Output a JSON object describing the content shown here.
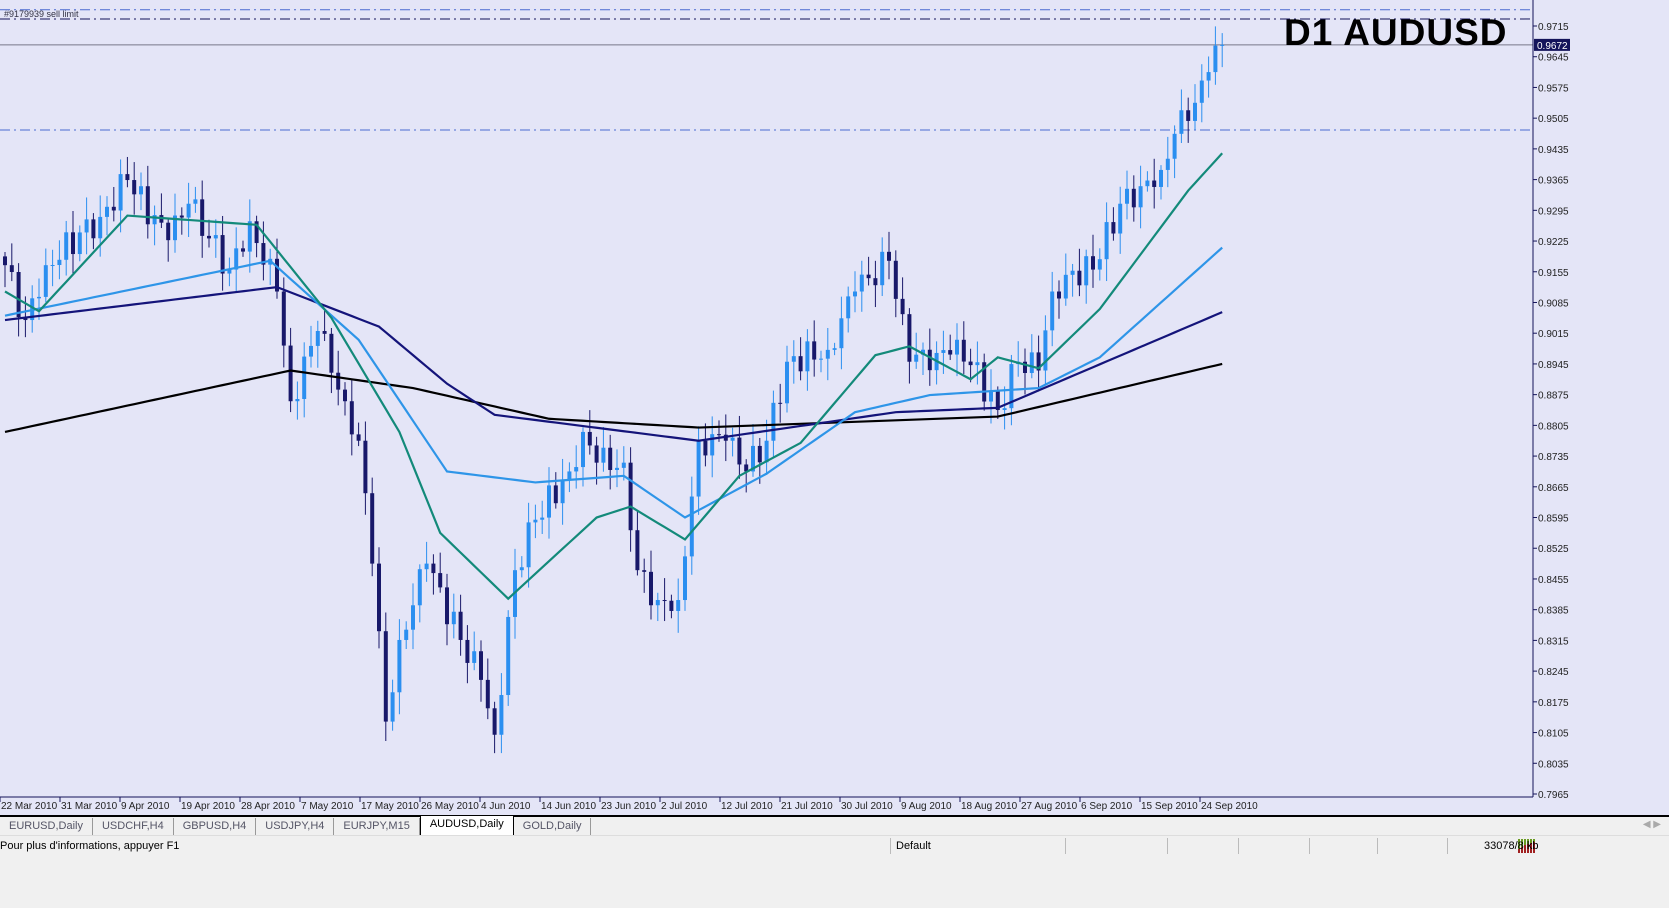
{
  "chart_title": "D1 AUDUSD",
  "order_label": "#9179939 sell limit",
  "current_price": "0.9672",
  "tabs": [
    {
      "label": "EURUSD,Daily",
      "active": false
    },
    {
      "label": "USDCHF,H4",
      "active": false
    },
    {
      "label": "GBPUSD,H4",
      "active": false
    },
    {
      "label": "USDJPY,H4",
      "active": false
    },
    {
      "label": "EURJPY,M15",
      "active": false
    },
    {
      "label": "AUDUSD,Daily",
      "active": true
    },
    {
      "label": "GOLD,Daily",
      "active": false
    }
  ],
  "status": {
    "help": "Pour plus d'informations, appuyer F1",
    "profile": "Default",
    "traffic": "33078/8 kb"
  },
  "colors": {
    "background": "#e4e5f7",
    "bull": "#2b8ff0",
    "bear": "#18186a",
    "ma10": "#138a7a",
    "ma20": "#2e95e8",
    "ma50": "#14147a",
    "ma200": "#000000"
  },
  "chart_data": {
    "type": "candlestick",
    "title": "D1 AUDUSD",
    "ylim": [
      0.7965,
      0.9715
    ],
    "yticks": [
      "0.9715",
      "0.9645",
      "0.9575",
      "0.9505",
      "0.9435",
      "0.9365",
      "0.9295",
      "0.9225",
      "0.9155",
      "0.9085",
      "0.9015",
      "0.8945",
      "0.8875",
      "0.8805",
      "0.8735",
      "0.8665",
      "0.8595",
      "0.8525",
      "0.8455",
      "0.8385",
      "0.8315",
      "0.8245",
      "0.8175",
      "0.8105",
      "0.8035",
      "0.7965"
    ],
    "xticks": [
      "22 Mar 2010",
      "31 Mar 2010",
      "9 Apr 2010",
      "19 Apr 2010",
      "28 Apr 2010",
      "7 May 2010",
      "17 May 2010",
      "26 May 2010",
      "4 Jun 2010",
      "14 Jun 2010",
      "23 Jun 2010",
      "2 Jul 2010",
      "12 Jul 2010",
      "21 Jul 2010",
      "30 Jul 2010",
      "9 Aug 2010",
      "18 Aug 2010",
      "27 Aug 2010",
      "6 Sep 2010",
      "15 Sep 2010",
      "24 Sep 2010"
    ],
    "bars": 180,
    "close_anchors": [
      [
        0,
        0.917
      ],
      [
        3,
        0.9045
      ],
      [
        6,
        0.917
      ],
      [
        14,
        0.928
      ],
      [
        18,
        0.9364
      ],
      [
        24,
        0.9227
      ],
      [
        27,
        0.931
      ],
      [
        33,
        0.916
      ],
      [
        36,
        0.927
      ],
      [
        40,
        0.911
      ],
      [
        42,
        0.886
      ],
      [
        46,
        0.902
      ],
      [
        50,
        0.886
      ],
      [
        52,
        0.877
      ],
      [
        54,
        0.849
      ],
      [
        56,
        0.813
      ],
      [
        58,
        0.8316
      ],
      [
        62,
        0.849
      ],
      [
        67,
        0.8316
      ],
      [
        70,
        0.8225
      ],
      [
        72,
        0.81
      ],
      [
        75,
        0.8475
      ],
      [
        78,
        0.859
      ],
      [
        83,
        0.87
      ],
      [
        85,
        0.879
      ],
      [
        87,
        0.872
      ],
      [
        91,
        0.872
      ],
      [
        93,
        0.8475
      ],
      [
        96,
        0.8407
      ],
      [
        99,
        0.8407
      ],
      [
        102,
        0.877
      ],
      [
        106,
        0.877
      ],
      [
        109,
        0.87
      ],
      [
        112,
        0.877
      ],
      [
        115,
        0.895
      ],
      [
        121,
        0.8977
      ],
      [
        125,
        0.911
      ],
      [
        130,
        0.918
      ],
      [
        133,
        0.895
      ],
      [
        137,
        0.897
      ],
      [
        140,
        0.9
      ],
      [
        146,
        0.884
      ],
      [
        149,
        0.895
      ],
      [
        152,
        0.893
      ],
      [
        154,
        0.911
      ],
      [
        156,
        0.9148
      ],
      [
        160,
        0.916
      ],
      [
        164,
        0.931
      ],
      [
        167,
        0.935
      ],
      [
        170,
        0.9387
      ],
      [
        173,
        0.9523
      ],
      [
        175,
        0.954
      ],
      [
        177,
        0.961
      ],
      [
        179,
        0.9672
      ]
    ],
    "moving_averages": [
      {
        "name": "MA200",
        "color": "#000000",
        "anchors": [
          [
            0,
            0.879
          ],
          [
            42,
            0.893
          ],
          [
            60,
            0.889
          ],
          [
            80,
            0.882
          ],
          [
            102,
            0.88
          ],
          [
            146,
            0.8825
          ],
          [
            179,
            0.8945
          ]
        ]
      },
      {
        "name": "MA50",
        "color": "#14147a",
        "anchors": [
          [
            0,
            0.9045
          ],
          [
            40,
            0.912
          ],
          [
            55,
            0.903
          ],
          [
            65,
            0.89
          ],
          [
            72,
            0.8829
          ],
          [
            102,
            0.877
          ],
          [
            131,
            0.8835
          ],
          [
            146,
            0.8845
          ],
          [
            179,
            0.9063
          ]
        ]
      },
      {
        "name": "MA20",
        "color": "#2e95e8",
        "anchors": [
          [
            0,
            0.9055
          ],
          [
            39,
            0.918
          ],
          [
            52,
            0.9
          ],
          [
            65,
            0.87
          ],
          [
            78,
            0.8675
          ],
          [
            91,
            0.869
          ],
          [
            100,
            0.8595
          ],
          [
            112,
            0.8695
          ],
          [
            125,
            0.8835
          ],
          [
            136,
            0.8874
          ],
          [
            152,
            0.889
          ],
          [
            161,
            0.896
          ],
          [
            179,
            0.921
          ]
        ]
      },
      {
        "name": "MA10",
        "color": "#138a7a",
        "anchors": [
          [
            0,
            0.911
          ],
          [
            5,
            0.9065
          ],
          [
            18,
            0.9283
          ],
          [
            37,
            0.9262
          ],
          [
            48,
            0.905
          ],
          [
            58,
            0.879
          ],
          [
            64,
            0.856
          ],
          [
            74,
            0.841
          ],
          [
            87,
            0.8595
          ],
          [
            92,
            0.862
          ],
          [
            100,
            0.8545
          ],
          [
            108,
            0.869
          ],
          [
            117,
            0.8765
          ],
          [
            128,
            0.8965
          ],
          [
            133,
            0.8985
          ],
          [
            142,
            0.891
          ],
          [
            146,
            0.896
          ],
          [
            152,
            0.8935
          ],
          [
            161,
            0.907
          ],
          [
            174,
            0.934
          ],
          [
            179,
            0.9425
          ]
        ]
      }
    ],
    "hlines": [
      {
        "price": 0.9752,
        "style": "dashdot",
        "color": "#4a6ad0"
      },
      {
        "price": 0.9731,
        "style": "dashdot",
        "color": "#14145a"
      },
      {
        "price": 0.9672,
        "style": "solid",
        "color": "#777788"
      },
      {
        "price": 0.9478,
        "style": "dashdot",
        "color": "#4a6ad0"
      }
    ]
  }
}
